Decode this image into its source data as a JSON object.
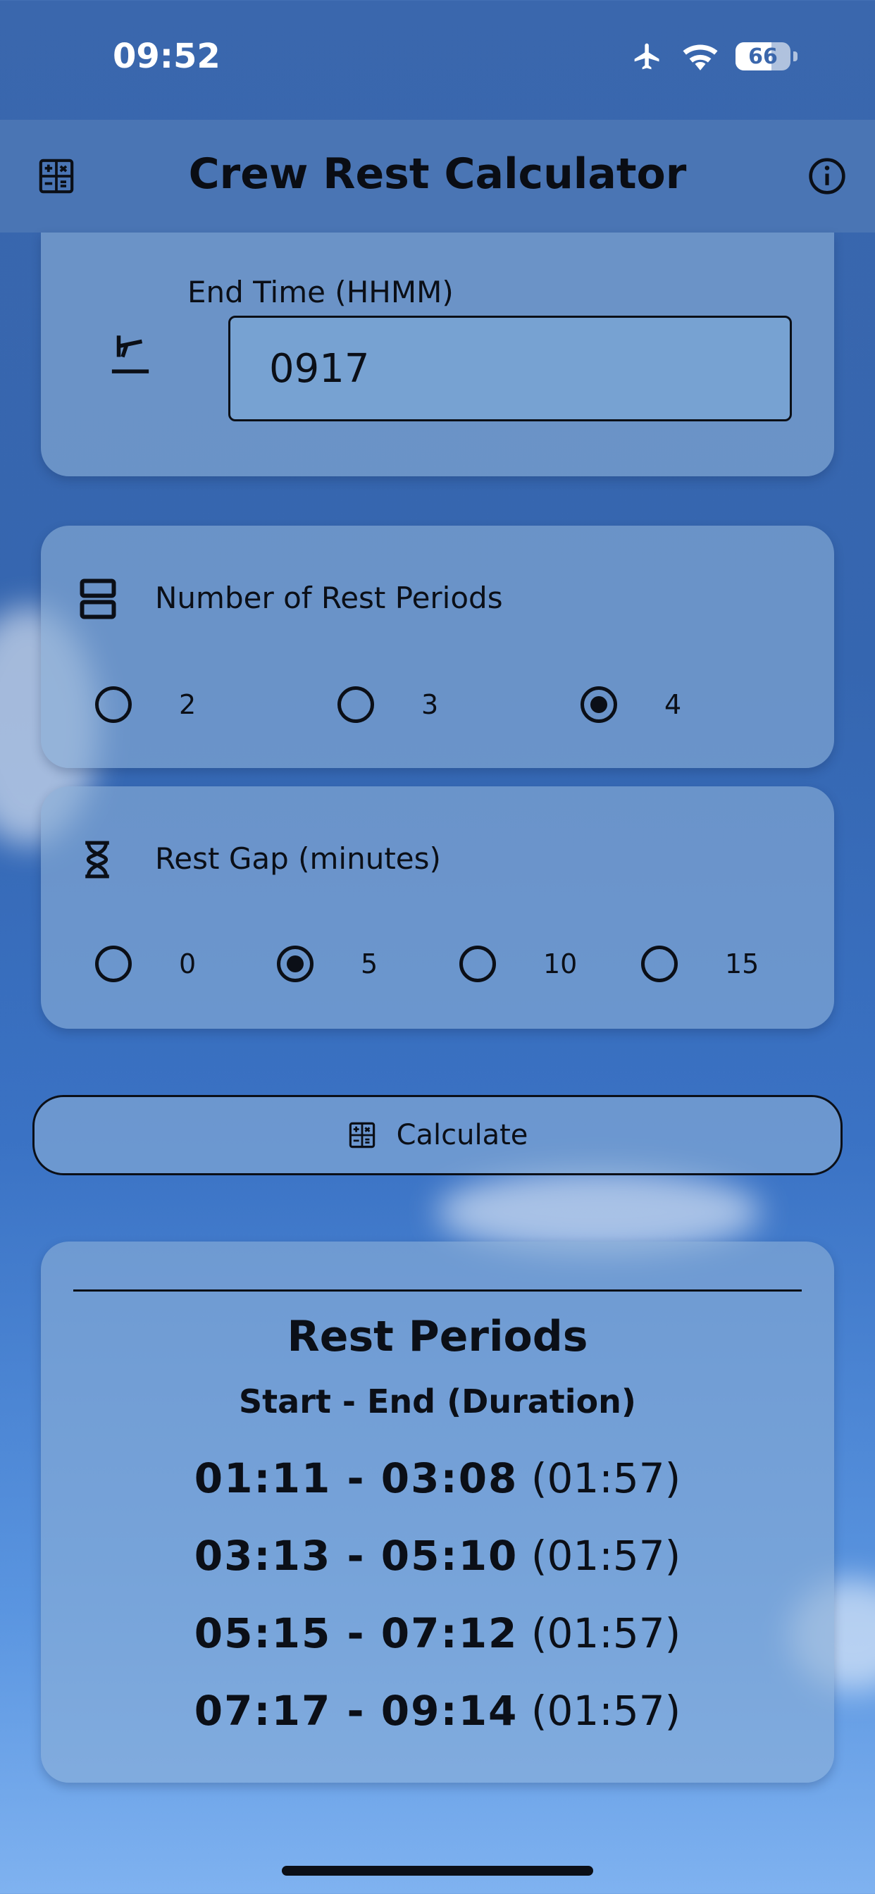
{
  "status_bar": {
    "time": "09:52",
    "battery": "66",
    "battery_level_percent": 66
  },
  "header": {
    "title": "Crew Rest Calculator",
    "left_icon": "calculator-icon",
    "right_icon": "info-icon"
  },
  "end_time": {
    "label": "End Time (HHMM)",
    "value": "0917",
    "icon": "plane-landing-icon"
  },
  "rest_periods": {
    "label": "Number of Rest Periods",
    "icon": "split-view-icon",
    "options": [
      "2",
      "3",
      "4"
    ],
    "selected": "4"
  },
  "rest_gap": {
    "label": "Rest Gap (minutes)",
    "icon": "hourglass-icon",
    "options": [
      "0",
      "5",
      "10",
      "15"
    ],
    "selected": "5"
  },
  "calculate_button": {
    "label": "Calculate",
    "icon": "calculator-icon"
  },
  "results": {
    "title": "Rest Periods",
    "subtitle": "Start - End (Duration)",
    "rows": [
      {
        "range": "01:11 - 03:08",
        "duration": "(01:57)"
      },
      {
        "range": "03:13 - 05:10",
        "duration": "(01:57)"
      },
      {
        "range": "05:15 - 07:12",
        "duration": "(01:57)"
      },
      {
        "range": "07:17 - 09:14",
        "duration": "(01:57)"
      }
    ]
  }
}
